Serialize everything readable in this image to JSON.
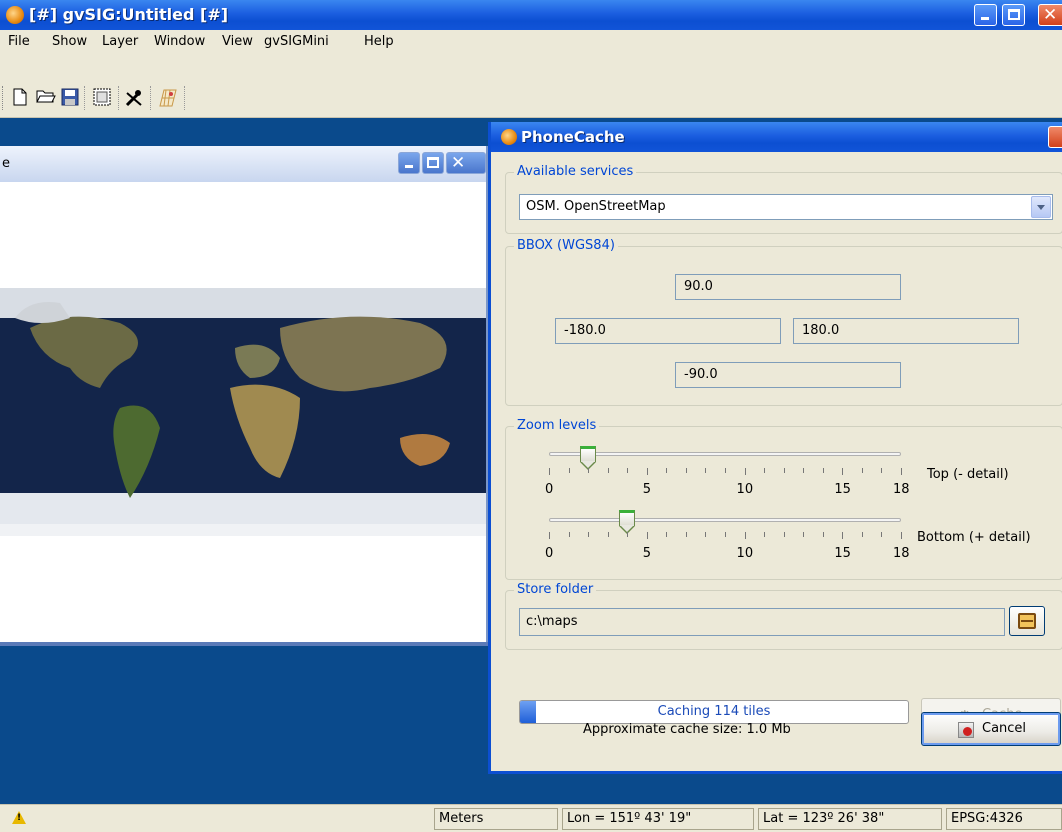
{
  "window": {
    "title": "[#] gvSIG:Untitled [#]",
    "accent": "#0c4fd2"
  },
  "menu": {
    "items": [
      "File",
      "Show",
      "Layer",
      "Window",
      "View",
      "gvSIGMini",
      "Help"
    ]
  },
  "toolbar": {
    "icons": [
      "new-document-icon",
      "open-folder-icon",
      "save-disk-icon",
      "map-frame-icon",
      "tools-icon",
      "layer-grid-icon"
    ]
  },
  "view": {
    "title_fragment": "e"
  },
  "dialog": {
    "title": "PhoneCache",
    "available_services": {
      "label": "Available services",
      "selected": "OSM. OpenStreetMap"
    },
    "bbox": {
      "label": "BBOX (WGS84)",
      "north": "90.0",
      "west": "-180.0",
      "east": "180.0",
      "south": "-90.0"
    },
    "zoom": {
      "label": "Zoom levels",
      "min": 0,
      "max": 18,
      "tick_labels": [
        "0",
        "5",
        "10",
        "15",
        "18"
      ],
      "top": {
        "label": "Top (- detail)",
        "value": 2
      },
      "bottom": {
        "label": "Bottom (+ detail)",
        "value": 4
      }
    },
    "store_folder": {
      "label": "Store folder",
      "value": "c:\\maps"
    },
    "progress": {
      "text": "Caching 114 tiles",
      "fraction": 0.04
    },
    "approx_size": "Approximate cache size: 1.0 Mb",
    "cache_button": "Cache",
    "cancel_button": "Cancel"
  },
  "status": {
    "units": "Meters",
    "lon": "Lon = 151º 43' 19\"",
    "lat": "Lat = 123º 26' 38\"",
    "crs": "EPSG:4326"
  }
}
